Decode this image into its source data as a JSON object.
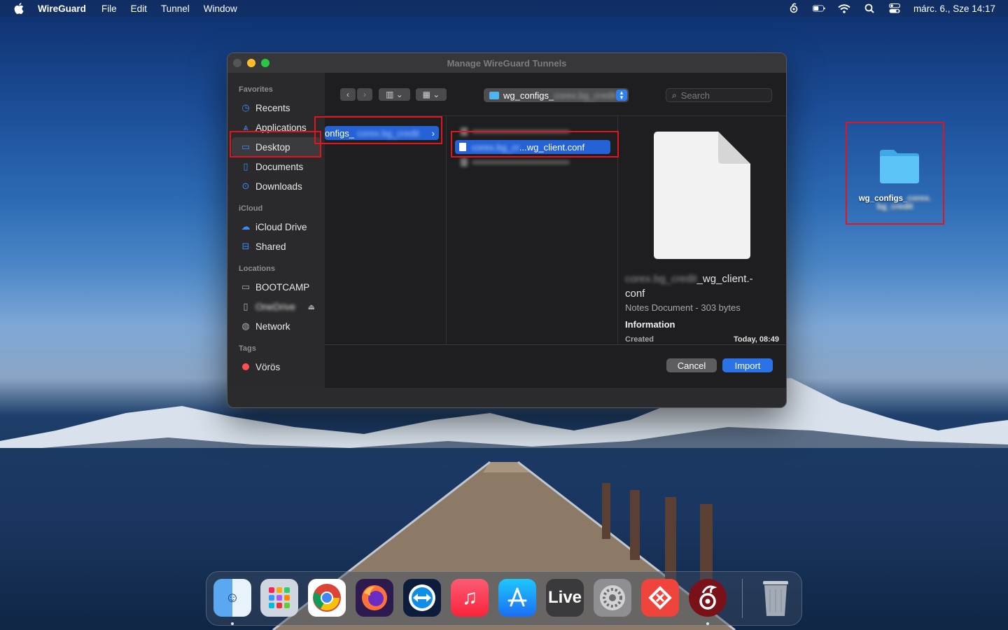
{
  "menubar": {
    "app_name": "WireGuard",
    "menus": [
      "File",
      "Edit",
      "Tunnel",
      "Window"
    ],
    "clock": "márc. 6., Sze  14:17",
    "status_icons": [
      "wireguard-icon",
      "battery-icon",
      "wifi-icon",
      "spotlight-icon",
      "control-center-icon"
    ]
  },
  "window": {
    "title": "Manage WireGuard Tunnels"
  },
  "dialog": {
    "sidebar": {
      "favorites_label": "Favorites",
      "favorites": [
        {
          "label": "Recents",
          "icon": "clock-icon"
        },
        {
          "label": "Applications",
          "icon": "applications-icon"
        },
        {
          "label": "Desktop",
          "icon": "desktop-icon"
        },
        {
          "label": "Documents",
          "icon": "document-icon"
        },
        {
          "label": "Downloads",
          "icon": "download-icon"
        }
      ],
      "icloud_label": "iCloud",
      "icloud": [
        {
          "label": "iCloud Drive",
          "icon": "cloud-icon"
        },
        {
          "label": "Shared",
          "icon": "shared-folder-icon"
        }
      ],
      "locations_label": "Locations",
      "locations": [
        {
          "label": "BOOTCAMP",
          "icon": "drive-icon"
        },
        {
          "label": "OneDrive",
          "icon": "file-icon"
        },
        {
          "label": "Network",
          "icon": "network-icon"
        }
      ],
      "tags_label": "Tags",
      "tags": [
        {
          "label": "Vörös",
          "color": "#ff4f4f"
        }
      ]
    },
    "toolbar": {
      "path": "wg_configs_",
      "path_blurred": "corex.bg_credit",
      "search_placeholder": "Search"
    },
    "column1": {
      "selected_folder": "onfigs_",
      "selected_folder_blurred": "corex.bg_credit"
    },
    "column2": {
      "selected_file_prefix": "corex.bg_cr",
      "selected_file": "...wg_client.conf"
    },
    "preview": {
      "name_blurred": "corex.bg_credit",
      "name_line1": "_wg_client.-",
      "name_line2": "conf",
      "kind": "Notes Document - 303 bytes",
      "info_heading": "Information",
      "created_label": "Created",
      "created_value": "Today, 08:49"
    },
    "buttons": {
      "cancel": "Cancel",
      "import": "Import"
    }
  },
  "desktop": {
    "folder_label": "wg_configs_",
    "folder_label_blurred": "corex. bg_credit"
  },
  "dock": {
    "apps": [
      "finder",
      "launchpad",
      "chrome",
      "firefox",
      "teamviewer",
      "music",
      "app-store",
      "live",
      "system-settings",
      "anydesk",
      "wireguard",
      "trash"
    ],
    "live_label": "Live"
  }
}
